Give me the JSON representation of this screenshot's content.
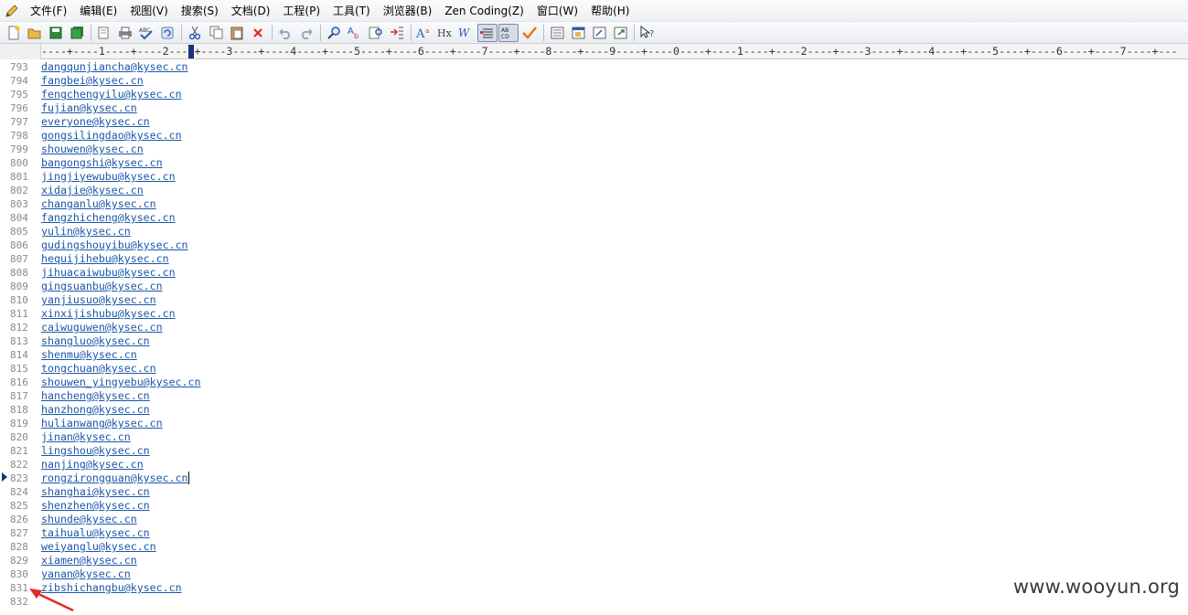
{
  "menu": [
    "文件(F)",
    "编辑(E)",
    "视图(V)",
    "搜索(S)",
    "文档(D)",
    "工程(P)",
    "工具(T)",
    "浏览器(B)",
    "Zen Coding(Z)",
    "窗口(W)",
    "帮助(H)"
  ],
  "ruler": "----+----1----+----2----+----3----+----4----+----5----+----6----+----7----+----8----+----9----+----0----+----1----+----2----+----3----+----4----+----5----+----6----+----7----+---",
  "lines": [
    {
      "num": "793",
      "text": "dangqunjiancha@kysec.cn"
    },
    {
      "num": "794",
      "text": "fangbei@kysec.cn"
    },
    {
      "num": "795",
      "text": "fengchengyilu@kysec.cn"
    },
    {
      "num": "796",
      "text": "fujian@kysec.cn"
    },
    {
      "num": "797",
      "text": "everyone@kysec.cn"
    },
    {
      "num": "798",
      "text": "gongsilingdao@kysec.cn"
    },
    {
      "num": "799",
      "text": "shouwen@kysec.cn"
    },
    {
      "num": "800",
      "text": "bangongshi@kysec.cn"
    },
    {
      "num": "801",
      "text": "jingjiyewubu@kysec.cn"
    },
    {
      "num": "802",
      "text": "xidajie@kysec.cn"
    },
    {
      "num": "803",
      "text": "changanlu@kysec.cn"
    },
    {
      "num": "804",
      "text": "fangzhicheng@kysec.cn"
    },
    {
      "num": "805",
      "text": "yulin@kysec.cn"
    },
    {
      "num": "806",
      "text": "gudingshouyibu@kysec.cn"
    },
    {
      "num": "807",
      "text": "hequijihebu@kysec.cn"
    },
    {
      "num": "808",
      "text": "jihuacaiwubu@kysec.cn"
    },
    {
      "num": "809",
      "text": "gingsuanbu@kysec.cn"
    },
    {
      "num": "810",
      "text": "yanjiusuo@kysec.cn"
    },
    {
      "num": "811",
      "text": "xinxijishubu@kysec.cn"
    },
    {
      "num": "812",
      "text": "caiwuguwen@kysec.cn"
    },
    {
      "num": "813",
      "text": "shangluo@kysec.cn"
    },
    {
      "num": "814",
      "text": "shenmu@kysec.cn"
    },
    {
      "num": "815",
      "text": "tongchuan@kysec.cn"
    },
    {
      "num": "816",
      "text": "shouwen_yingyebu@kysec.cn"
    },
    {
      "num": "817",
      "text": "hancheng@kysec.cn"
    },
    {
      "num": "818",
      "text": "hanzhong@kysec.cn"
    },
    {
      "num": "819",
      "text": "hulianwang@kysec.cn"
    },
    {
      "num": "820",
      "text": "jinan@kysec.cn"
    },
    {
      "num": "821",
      "text": "lingshou@kysec.cn"
    },
    {
      "num": "822",
      "text": "nanjing@kysec.cn"
    },
    {
      "num": "823",
      "text": "rongzirongguan@kysec.cn"
    },
    {
      "num": "824",
      "text": "shanghai@kysec.cn"
    },
    {
      "num": "825",
      "text": "shenzhen@kysec.cn"
    },
    {
      "num": "826",
      "text": "shunde@kysec.cn"
    },
    {
      "num": "827",
      "text": "taihualu@kysec.cn"
    },
    {
      "num": "828",
      "text": "weiyanglu@kysec.cn"
    },
    {
      "num": "829",
      "text": "xiamen@kysec.cn"
    },
    {
      "num": "830",
      "text": "yanan@kysec.cn"
    },
    {
      "num": "831",
      "text": "zibshichangbu@kysec.cn"
    },
    {
      "num": "832",
      "text": ""
    }
  ],
  "watermark": "www.wooyun.org",
  "colors": {
    "link": "#1a57a8",
    "line_number": "#8a8a8a",
    "arrow": "#e02a22"
  }
}
